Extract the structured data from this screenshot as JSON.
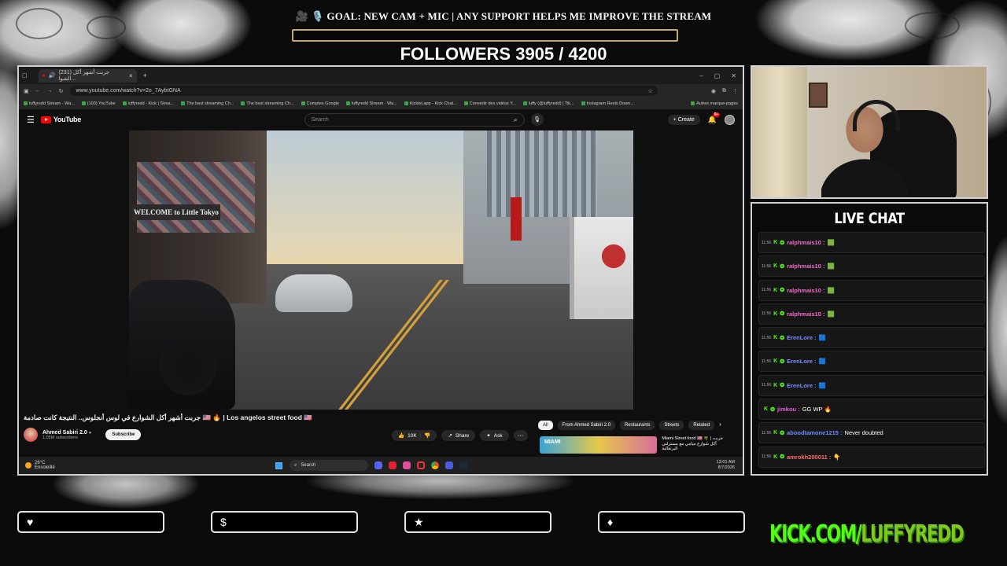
{
  "overlay": {
    "goal_text": "🎥 🎙️ GOAL: NEW CAM + MIC | ANY SUPPORT HELPS ME IMPROVE THE STREAM",
    "goal_progress": 0,
    "followers_text": "FOLLOWERS 3905 / 4200",
    "kick_prefix": "KICK.COM/",
    "kick_user": "LUFFYREDD",
    "panel_icons": [
      "heart-icon",
      "dollar-icon",
      "star-icon",
      "drop-icon"
    ],
    "panel_glyphs": [
      "♥",
      "$",
      "★",
      "♦"
    ],
    "accent": "#53fc18"
  },
  "browser": {
    "tab_title": "(231) جربت أشهر أكل الشوا...",
    "new_tab": "+",
    "url": "www.youtube.com/watch?v=2o_7AybtGNA",
    "bookmarks": [
      "luffyredd Stream - Wa...",
      "(100) YouTube",
      "luffyredd - Kick | Strea...",
      "The best streaming Ch...",
      "The best streaming Ch...",
      "Comptes Google",
      "luffyredd Stream - Wa...",
      "Kicklet.app - Kick Chat...",
      "Convertir des vidéos Y...",
      "luffy (@luffyredd) | Tik...",
      "Instagram Reels Down...",
      "Autres marque-pages"
    ]
  },
  "youtube": {
    "logo": "YouTube",
    "search_placeholder": "Search",
    "create_label": "Create",
    "notif_count": "9+",
    "video_sign": "WELCOME to Little Tokyo",
    "video_title": "جربت أشهر أكل الشوارع في لوس أنجلوس.. النتيجة كانت صادمة 🇺🇸 🔥 | Los angelos street food 🇺🇸",
    "channel_name": "Ahmed Sabiri 2.0",
    "subscribers": "1.05M subscribers",
    "subscribe_label": "Subscribe",
    "likes": "10K",
    "share_label": "Share",
    "ask_label": "Ask",
    "chips": [
      "All",
      "From Ahmed Sabiri 2.0",
      "Restaurants",
      "Streets",
      "Related"
    ],
    "related_thumb_text": "MIAMI",
    "related_title": "Miami Street food 🇺🇸 🌴 | جربت أكل شوارع ميامي مع مسترلتي البرتغالية"
  },
  "taskbar": {
    "temperature": "26°C",
    "weather": "Ensoleillé",
    "search": "Search",
    "time": "13:01 AM",
    "date": "8/7/2026"
  },
  "chat": {
    "title": "LIVE CHAT",
    "messages": [
      {
        "badge": "11:56",
        "user": "ralphmais10 :",
        "text": "🟩",
        "color": "#f06bc9"
      },
      {
        "badge": "11:56",
        "user": "ralphmais10 :",
        "text": "🟩",
        "color": "#f06bc9"
      },
      {
        "badge": "11:56",
        "user": "ralphmais10 :",
        "text": "🟩",
        "color": "#f06bc9"
      },
      {
        "badge": "11:56",
        "user": "ralphmais10 :",
        "text": "🟩",
        "color": "#f06bc9"
      },
      {
        "badge": "11:56",
        "user": "ErenLore :",
        "text": "🟦",
        "color": "#7c8cff"
      },
      {
        "badge": "11:56",
        "user": "ErenLore :",
        "text": "🟦",
        "color": "#7c8cff"
      },
      {
        "badge": "11:56",
        "user": "ErenLore :",
        "text": "🟦",
        "color": "#7c8cff"
      },
      {
        "badge": "",
        "user": "jimkou : ",
        "text": "GG WP 🔥",
        "color": "#e45bd9"
      },
      {
        "badge": "11:56",
        "user": "aboodtamone1215 : ",
        "text": "Never doubted",
        "color": "#6f8cff"
      },
      {
        "badge": "11:56",
        "user": "amrokh200011 : ",
        "text": "👇",
        "color": "#ff6b6b"
      }
    ]
  }
}
